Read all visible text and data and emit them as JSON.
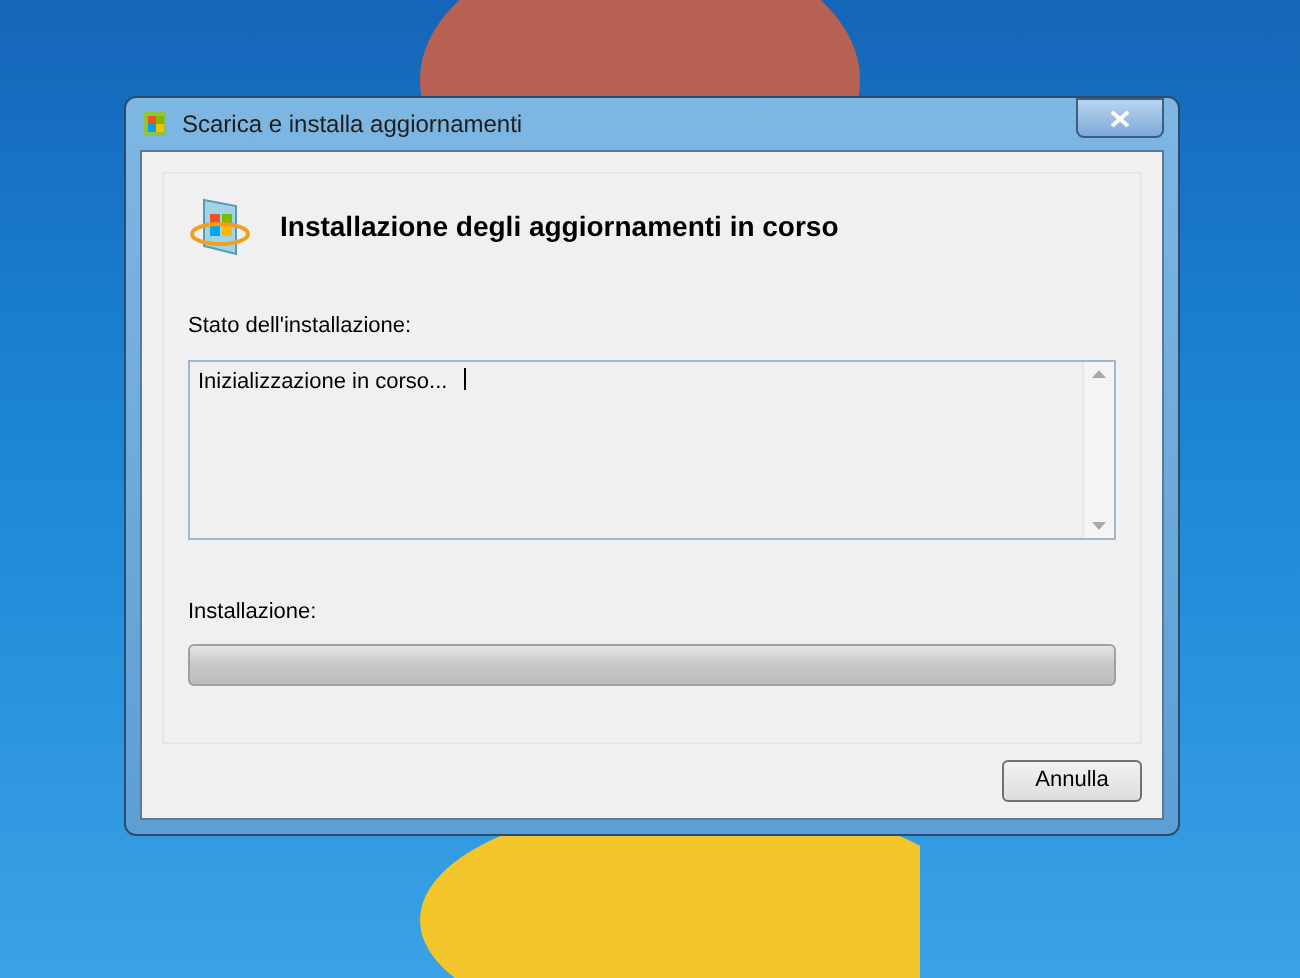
{
  "window": {
    "title": "Scarica e installa aggiornamenti"
  },
  "heading": "Installazione degli aggiornamenti in corso",
  "status": {
    "label": "Stato dell'installazione:",
    "value": "Inizializzazione in corso..."
  },
  "progress": {
    "label": "Installazione:",
    "level": 0
  },
  "buttons": [
    "Annulla"
  ]
}
